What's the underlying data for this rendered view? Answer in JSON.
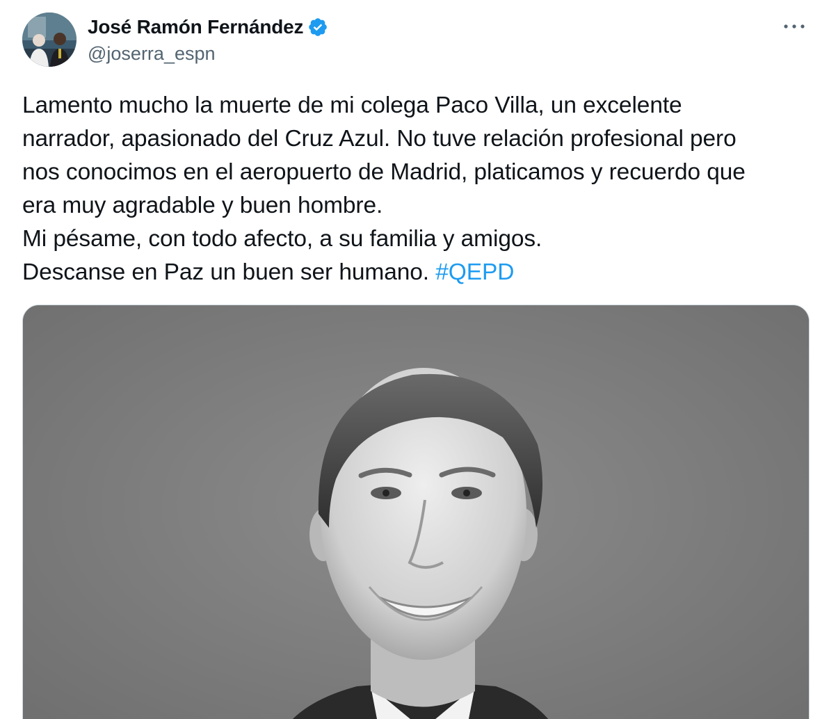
{
  "author": {
    "display_name": "José Ramón Fernández",
    "handle": "@joserra_espn",
    "verified": true,
    "verified_color": "#1d9bf0"
  },
  "tweet": {
    "lines": [
      "Lamento mucho la muerte de mi colega Paco Villa, un excelente",
      "narrador, apasionado del Cruz Azul. No tuve relación profesional pero",
      "nos conocimos en el aeropuerto de Madrid, platicamos y recuerdo que",
      "era muy agradable y buen hombre.",
      "Mi pésame, con todo afecto, a su familia y amigos.",
      "Descanse en Paz un buen ser humano."
    ],
    "hashtag": "#QEPD",
    "hashtag_color": "#1d9bf0"
  },
  "icons": {
    "verified": "verified-badge-icon",
    "more": "more-options-icon"
  }
}
